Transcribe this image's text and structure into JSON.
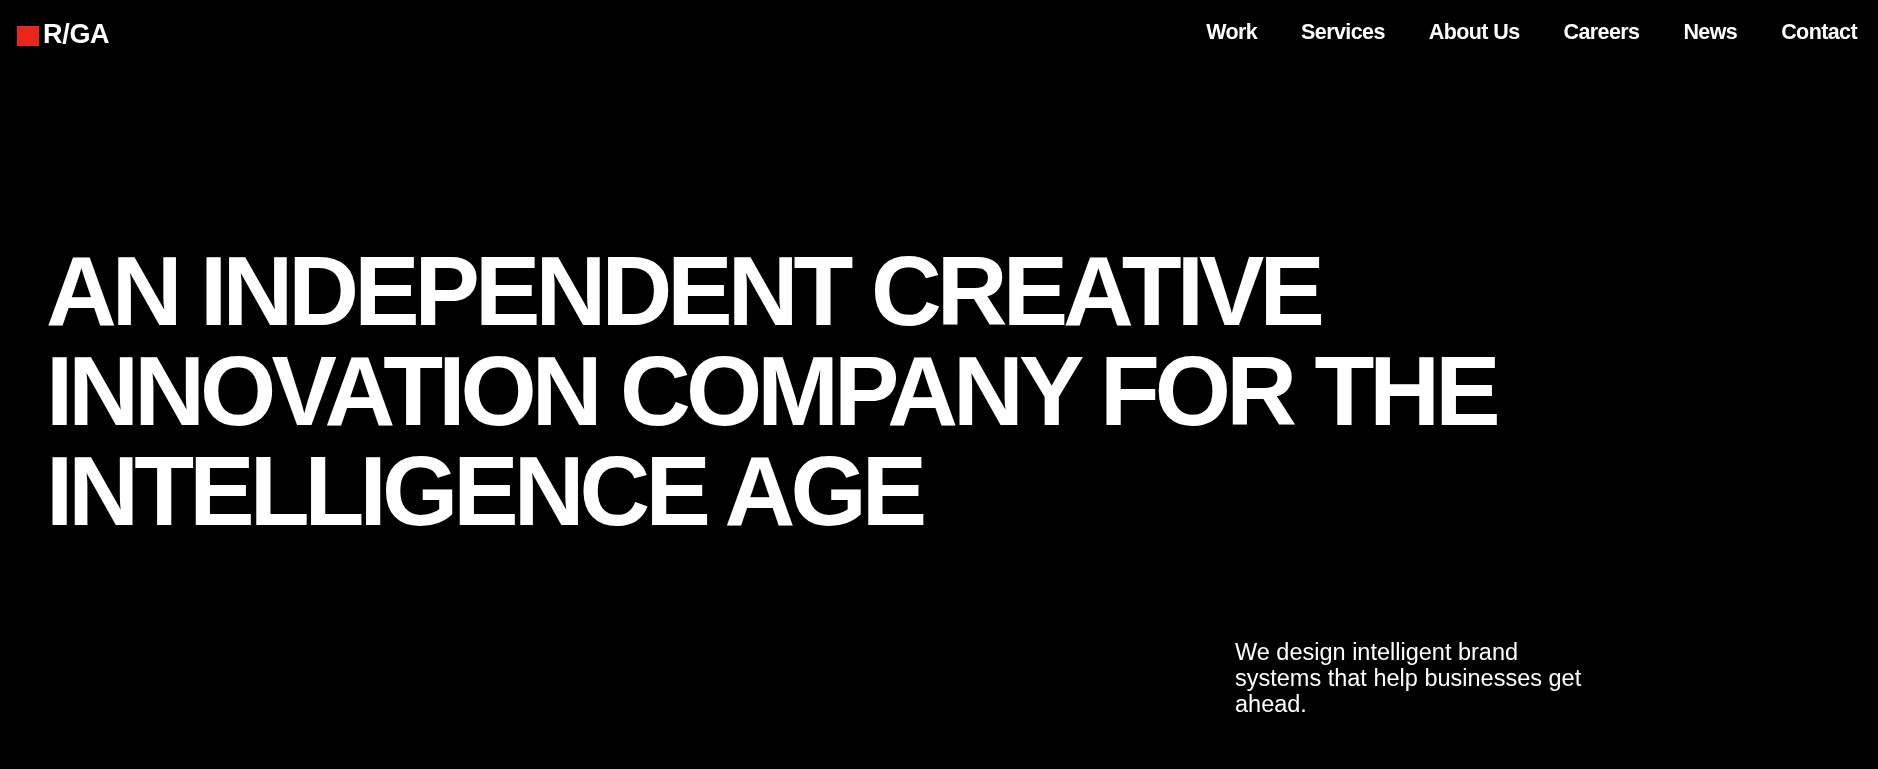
{
  "header": {
    "logo": {
      "text": "R/GA"
    },
    "nav": [
      {
        "label": "Work"
      },
      {
        "label": "Services"
      },
      {
        "label": "About Us"
      },
      {
        "label": "Careers"
      },
      {
        "label": "News"
      },
      {
        "label": "Contact"
      }
    ]
  },
  "hero": {
    "headline": "AN INDEPENDENT CREATIVE INNOVATION COMPANY FOR THE INTELLIGENCE AGE",
    "tagline": "We design intelligent brand systems that help businesses get ahead."
  }
}
